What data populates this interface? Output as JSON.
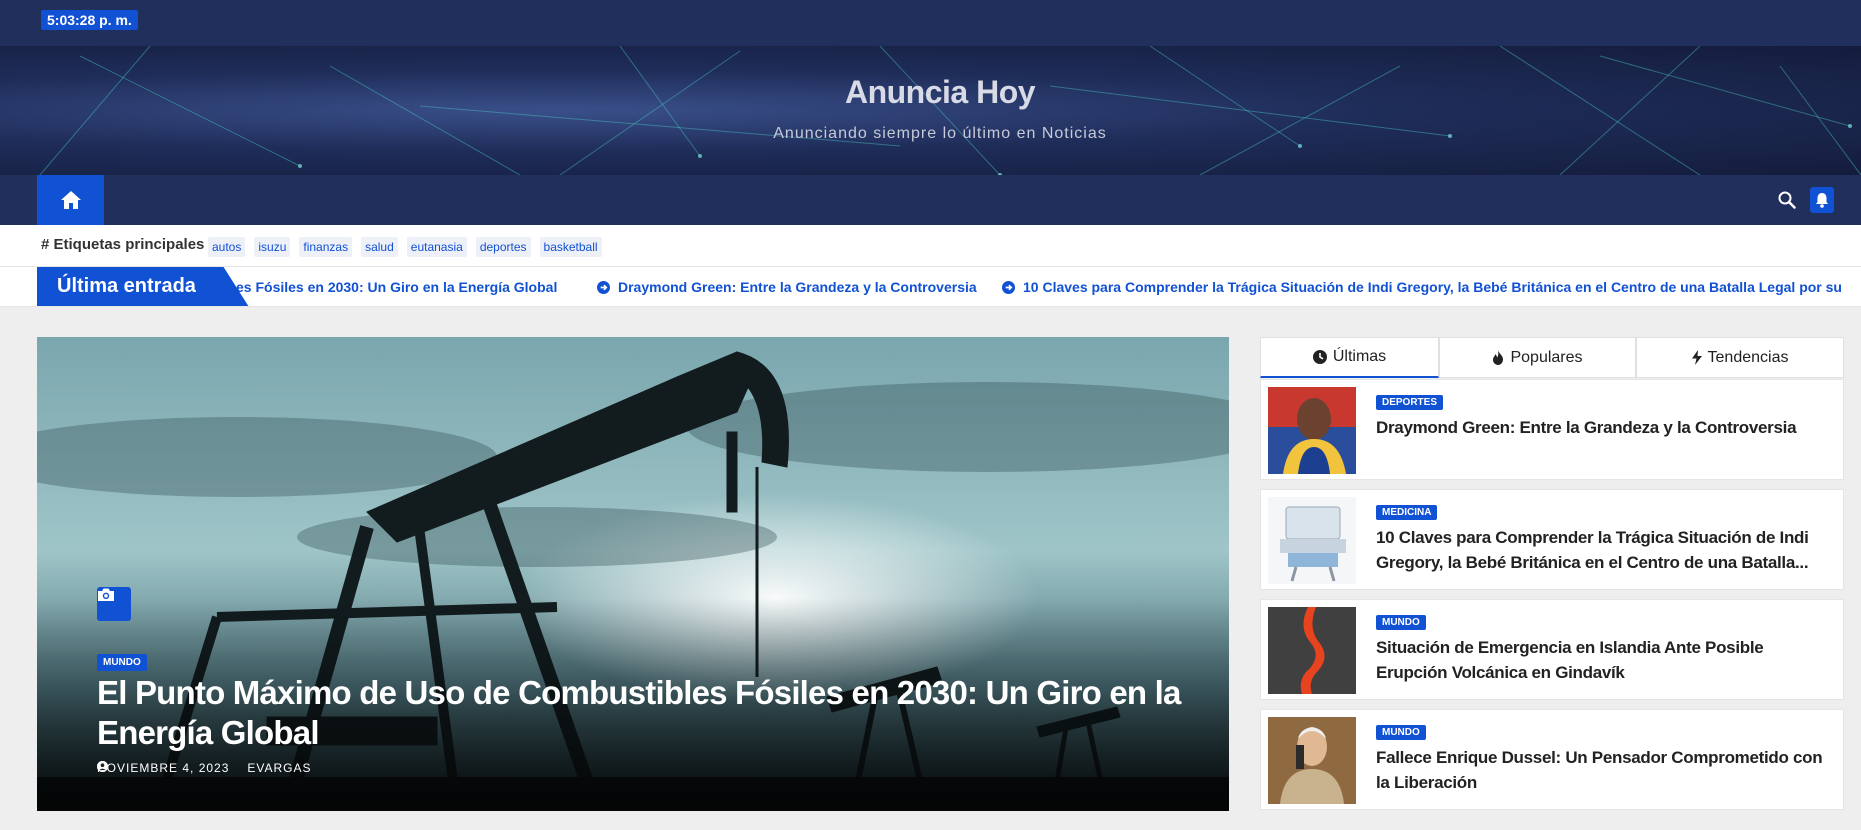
{
  "topbar": {
    "clock": "5:03:28 p. m."
  },
  "header": {
    "site_title": "Anuncia Hoy",
    "tagline": "Anunciando siempre lo último en Noticias"
  },
  "nav": {
    "home_icon": "home-icon",
    "search_icon": "search-icon",
    "bell_icon": "bell-icon"
  },
  "tags": {
    "label": "# Etiquetas principales",
    "items": [
      "autos",
      "isuzu",
      "finanzas",
      "salud",
      "eutanasia",
      "deportes",
      "basketball"
    ]
  },
  "ticker": {
    "label": "Última entrada",
    "items": [
      "es Fósiles en 2030: Un Giro en la Energía Global",
      "Draymond Green: Entre la Grandeza y la Controversia",
      "10 Claves para Comprender la Trágica Situación de Indi Gregory, la Bebé Británica en el Centro de una Batalla Legal por su"
    ]
  },
  "hero": {
    "category": "MUNDO",
    "title": "El Punto Máximo de Uso de Combustibles Fósiles en 2030: Un Giro en la Energía Global",
    "date": "NOVIEMBRE 4, 2023",
    "author": "EVARGAS"
  },
  "sidebar": {
    "tabs": [
      {
        "label": "Últimas",
        "icon": "clock-icon"
      },
      {
        "label": "Populares",
        "icon": "fire-icon"
      },
      {
        "label": "Tendencias",
        "icon": "bolt-icon"
      }
    ],
    "posts": [
      {
        "category": "DEPORTES",
        "title": "Draymond Green: Entre la Grandeza y la Controversia"
      },
      {
        "category": "MEDICINA",
        "title": "10 Claves para Comprender la Trágica Situación de Indi Gregory, la Bebé Británica en el Centro de una Batalla..."
      },
      {
        "category": "MUNDO",
        "title": "Situación de Emergencia en Islandia Ante Posible Erupción Volcánica en Gindavík"
      },
      {
        "category": "MUNDO",
        "title": "Fallece Enrique Dussel: Un Pensador Comprometido con la Liberación"
      }
    ]
  },
  "colors": {
    "navy": "#202f5b",
    "accent": "#1151d3",
    "background": "#eeeeee"
  }
}
